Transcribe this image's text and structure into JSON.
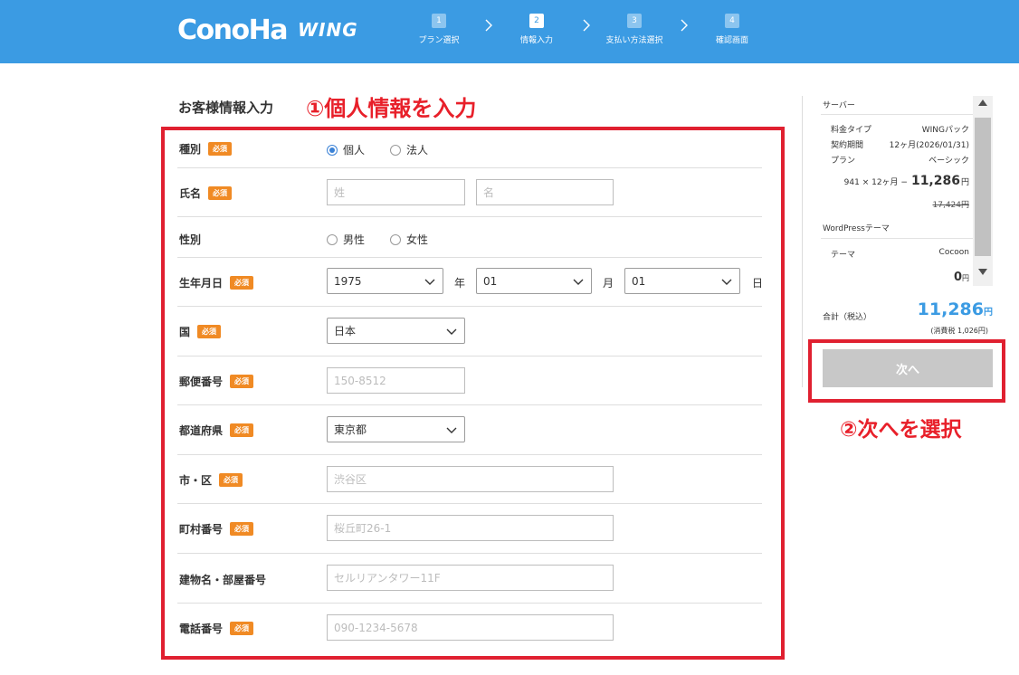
{
  "header": {
    "logo_main": "ConoHa",
    "logo_sub": "WING",
    "steps": [
      {
        "num": "1",
        "label": "プラン選択"
      },
      {
        "num": "2",
        "label": "情報入力"
      },
      {
        "num": "3",
        "label": "支払い方法選択"
      },
      {
        "num": "4",
        "label": "確認画面"
      }
    ],
    "active_step": 2
  },
  "page": {
    "section_title": "お客様情報入力",
    "annotation_form": "①個人情報を入力",
    "annotation_next": "②次へを選択"
  },
  "form": {
    "required_badge": "必須",
    "type": {
      "label": "種別",
      "options": [
        "個人",
        "法人"
      ],
      "selected": "個人"
    },
    "name": {
      "label": "氏名",
      "last_placeholder": "姓",
      "first_placeholder": "名"
    },
    "gender": {
      "label": "性別",
      "options": [
        "男性",
        "女性"
      ],
      "selected": ""
    },
    "birthdate": {
      "label": "生年月日",
      "year": "1975",
      "year_unit": "年",
      "month": "01",
      "month_unit": "月",
      "day": "01",
      "day_unit": "日"
    },
    "country": {
      "label": "国",
      "value": "日本"
    },
    "postal": {
      "label": "郵便番号",
      "placeholder": "150-8512"
    },
    "prefecture": {
      "label": "都道府県",
      "value": "東京都"
    },
    "city": {
      "label": "市・区",
      "placeholder": "渋谷区"
    },
    "town": {
      "label": "町村番号",
      "placeholder": "桜丘町26-1"
    },
    "building": {
      "label": "建物名・部屋番号",
      "placeholder": "セルリアンタワー11F"
    },
    "phone": {
      "label": "電話番号",
      "placeholder": "090-1234-5678"
    }
  },
  "summary": {
    "server_heading": "サーバー",
    "rows": [
      {
        "key": "料金タイプ",
        "value": "WINGパック"
      },
      {
        "key": "契約期間",
        "value": "12ヶ月(2026/01/31)"
      },
      {
        "key": "プラン",
        "value": "ベーシック"
      }
    ],
    "calc_prefix": "941 × 12ヶ月 −",
    "calc_price": "11,286",
    "calc_unit": "円",
    "original_price": "17,424円",
    "wp_heading": "WordPressテーマ",
    "theme_key": "テーマ",
    "theme_value": "Cocoon",
    "theme_price": "0",
    "theme_unit": "円"
  },
  "total": {
    "label": "合計（税込）",
    "value": "11,286",
    "unit": "円",
    "tax": "(消費税 1,026円)"
  },
  "next_button": "次へ",
  "colors": {
    "header_bg": "#3b9be3",
    "badge": "#f08a24",
    "annotation": "#e8202a",
    "total": "#3b9be3",
    "button_disabled": "#c8c8c8"
  }
}
